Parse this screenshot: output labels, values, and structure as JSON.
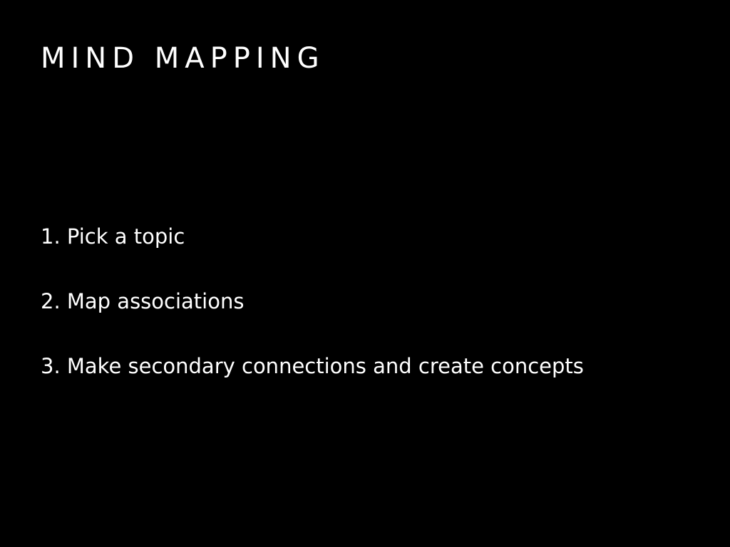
{
  "slide": {
    "title": "MIND MAPPING",
    "background_color": "#000000",
    "text_color": "#ffffff",
    "steps": [
      "1. Pick a topic",
      "2. Map associations",
      "3. Make secondary connections and create concepts"
    ]
  }
}
